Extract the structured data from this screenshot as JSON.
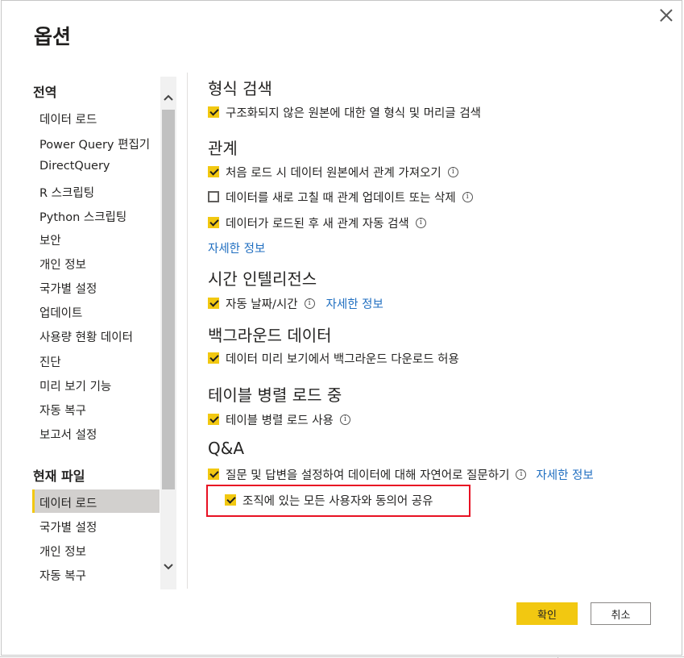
{
  "window": {
    "title": "옵션"
  },
  "sidebar": {
    "global_heading": "전역",
    "global_items": [
      "데이터 로드",
      "Power Query 편집기",
      "DirectQuery",
      "R 스크립팅",
      "Python 스크립팅",
      "보안",
      "개인 정보",
      "국가별 설정",
      "업데이트",
      "사용량 현황 데이터",
      "진단",
      "미리 보기 기능",
      "자동 복구",
      "보고서 설정"
    ],
    "file_heading": "현재 파일",
    "file_items": [
      "데이터 로드",
      "국가별 설정",
      "개인 정보",
      "자동 복구"
    ],
    "selected": "현재 파일 > 데이터 로드"
  },
  "content": {
    "type_detection": {
      "heading": "형식 검색",
      "opt1": "구조화되지 않은 원본에 대한 열 형식 및 머리글 검색"
    },
    "relationships": {
      "heading": "관계",
      "opt1": "처음 로드 시 데이터 원본에서 관계 가져오기",
      "opt2": "데이터를 새로 고칠 때 관계 업데이트 또는 삭제",
      "opt3": "데이터가 로드된 후 새 관계 자동 검색",
      "learn_more": "자세한 정보"
    },
    "time_intelligence": {
      "heading": "시간 인텔리전스",
      "opt1": "자동 날짜/시간",
      "learn_more": "자세한 정보"
    },
    "background_data": {
      "heading": "백그라운드 데이터",
      "opt1": "데이터 미리 보기에서 백그라운드 다운로드 허용"
    },
    "parallel_load": {
      "heading": "테이블 병렬 로드 중",
      "opt1": "테이블 병렬 로드 사용"
    },
    "qna": {
      "heading": "Q&A",
      "opt1": "질문 및 답변을 설정하여 데이터에 대해 자연어로 질문하기",
      "learn_more": "자세한 정보",
      "opt2": "조직에 있는 모든 사용자와 동의어 공유"
    },
    "info_glyph": "i"
  },
  "footer": {
    "ok_label": "확인",
    "cancel_label": "취소"
  },
  "colors": {
    "accent": "#f2c811",
    "link": "#1f6ec0",
    "highlight": "#e81123"
  },
  "icons": [
    "close-icon",
    "chevron-up-icon",
    "chevron-down-icon",
    "checkbox-checked-icon",
    "checkbox-unchecked-icon",
    "info-icon"
  ]
}
